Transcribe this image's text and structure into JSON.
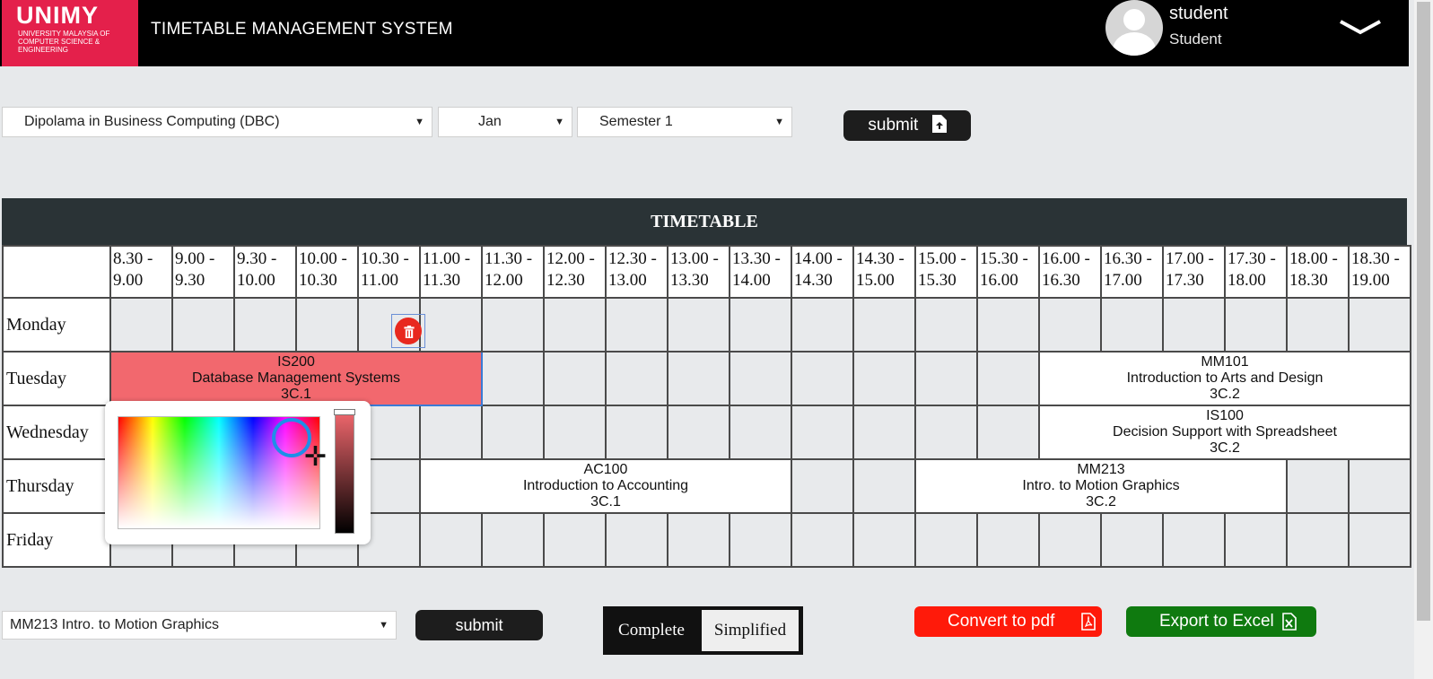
{
  "header": {
    "logo_text": "UNIMY",
    "logo_subtext": "UNIVERSITY MALAYSIA OF COMPUTER SCIENCE & ENGINEERING",
    "title": "TIMETABLE MANAGEMENT SYSTEM",
    "user_name": "student",
    "user_role": "Student"
  },
  "filters": {
    "program": "Dipolama in Business Computing (DBC)",
    "month": "Jan",
    "semester": "Semester 1",
    "submit_label": "submit"
  },
  "timetable": {
    "title": "TIMETABLE",
    "time_slots": [
      "8.30 - 9.00",
      "9.00 - 9.30",
      "9.30 - 10.00",
      "10.00 - 10.30",
      "10.30 - 11.00",
      "11.00 - 11.30",
      "11.30 - 12.00",
      "12.00 - 12.30",
      "12.30 - 13.00",
      "13.00 - 13.30",
      "13.30 - 14.00",
      "14.00 - 14.30",
      "14.30 - 15.00",
      "15.00 - 15.30",
      "15.30 - 16.00",
      "16.00 - 16.30",
      "16.30 - 17.00",
      "17.00 - 17.30",
      "17.30 - 18.00",
      "18.00 - 18.30",
      "18.30 - 19.00"
    ],
    "days": [
      "Monday",
      "Tuesday",
      "Wednesday",
      "Thursday",
      "Friday"
    ],
    "classes": {
      "tue_is200": {
        "code": "IS200",
        "name": "Database Management Systems",
        "room": "3C.1"
      },
      "tue_mm101": {
        "code": "MM101",
        "name": "Introduction to Arts and Design",
        "room": "3C.2"
      },
      "wed_is100": {
        "code": "IS100",
        "name": "Decision Support with Spreadsheet",
        "room": "3C.2"
      },
      "thu_ac100": {
        "code": "AC100",
        "name": "Introduction to Accounting",
        "room": "3C.1"
      },
      "thu_mm213": {
        "code": "MM213",
        "name": "Intro. to Motion Graphics",
        "room": "3C.2"
      }
    },
    "highlight_color": "#f2686e"
  },
  "bottom": {
    "subject_select": "MM213 Intro. to Motion Graphics",
    "submit_label": "submit",
    "view_complete": "Complete",
    "view_simplified": "Simplified",
    "convert_pdf": "Convert to pdf",
    "export_excel": "Export to Excel",
    "pdf_color": "#ff1a0a",
    "excel_color": "#0f7a0f"
  },
  "icons": [
    "chevron-down-icon",
    "user-avatar-icon",
    "upload-file-icon",
    "trash-icon",
    "pdf-file-icon",
    "excel-file-icon"
  ]
}
